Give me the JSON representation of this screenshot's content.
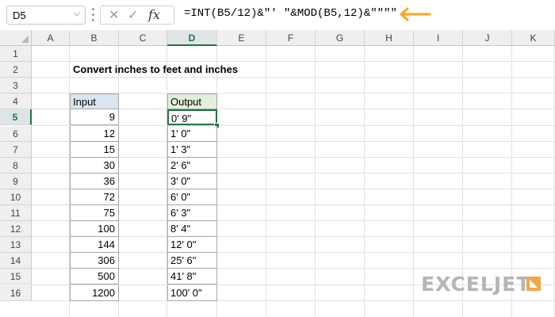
{
  "formula_bar": {
    "name_box": "D5",
    "formula": "=INT(B5/12)&\"' \"&MOD(B5,12)&\"\"\"\"",
    "fx_label": "fx",
    "cancel_icon": "x-icon",
    "enter_icon": "check-icon",
    "accent_arrow_color": "#f5a623"
  },
  "columns": [
    "A",
    "B",
    "C",
    "D",
    "E",
    "F",
    "G",
    "H",
    "I",
    "J",
    "K"
  ],
  "rows": [
    "1",
    "2",
    "3",
    "4",
    "5",
    "6",
    "7",
    "8",
    "9",
    "10",
    "11",
    "12",
    "13",
    "14",
    "15",
    "16"
  ],
  "selected_column": "D",
  "selected_row": "5",
  "sheet": {
    "title": "Convert inches to feet and inches",
    "input_header": "Input",
    "output_header": "Output",
    "inputs": [
      "9",
      "12",
      "15",
      "30",
      "36",
      "72",
      "75",
      "100",
      "144",
      "306",
      "500",
      "1200"
    ],
    "outputs": [
      "0' 9\"",
      "1' 0\"",
      "1' 3\"",
      "2' 6\"",
      "3' 0\"",
      "6' 0\"",
      "6' 3\"",
      "8' 4\"",
      "12' 0\"",
      "25' 6\"",
      "41' 8\"",
      "100' 0\""
    ]
  },
  "brand": {
    "logo_text": "EXCELJET",
    "logo_color": "#f0a84a"
  },
  "colors": {
    "selection_green": "#217346",
    "input_header_fill": "#dbe4f1",
    "output_header_fill": "#e2efda"
  }
}
